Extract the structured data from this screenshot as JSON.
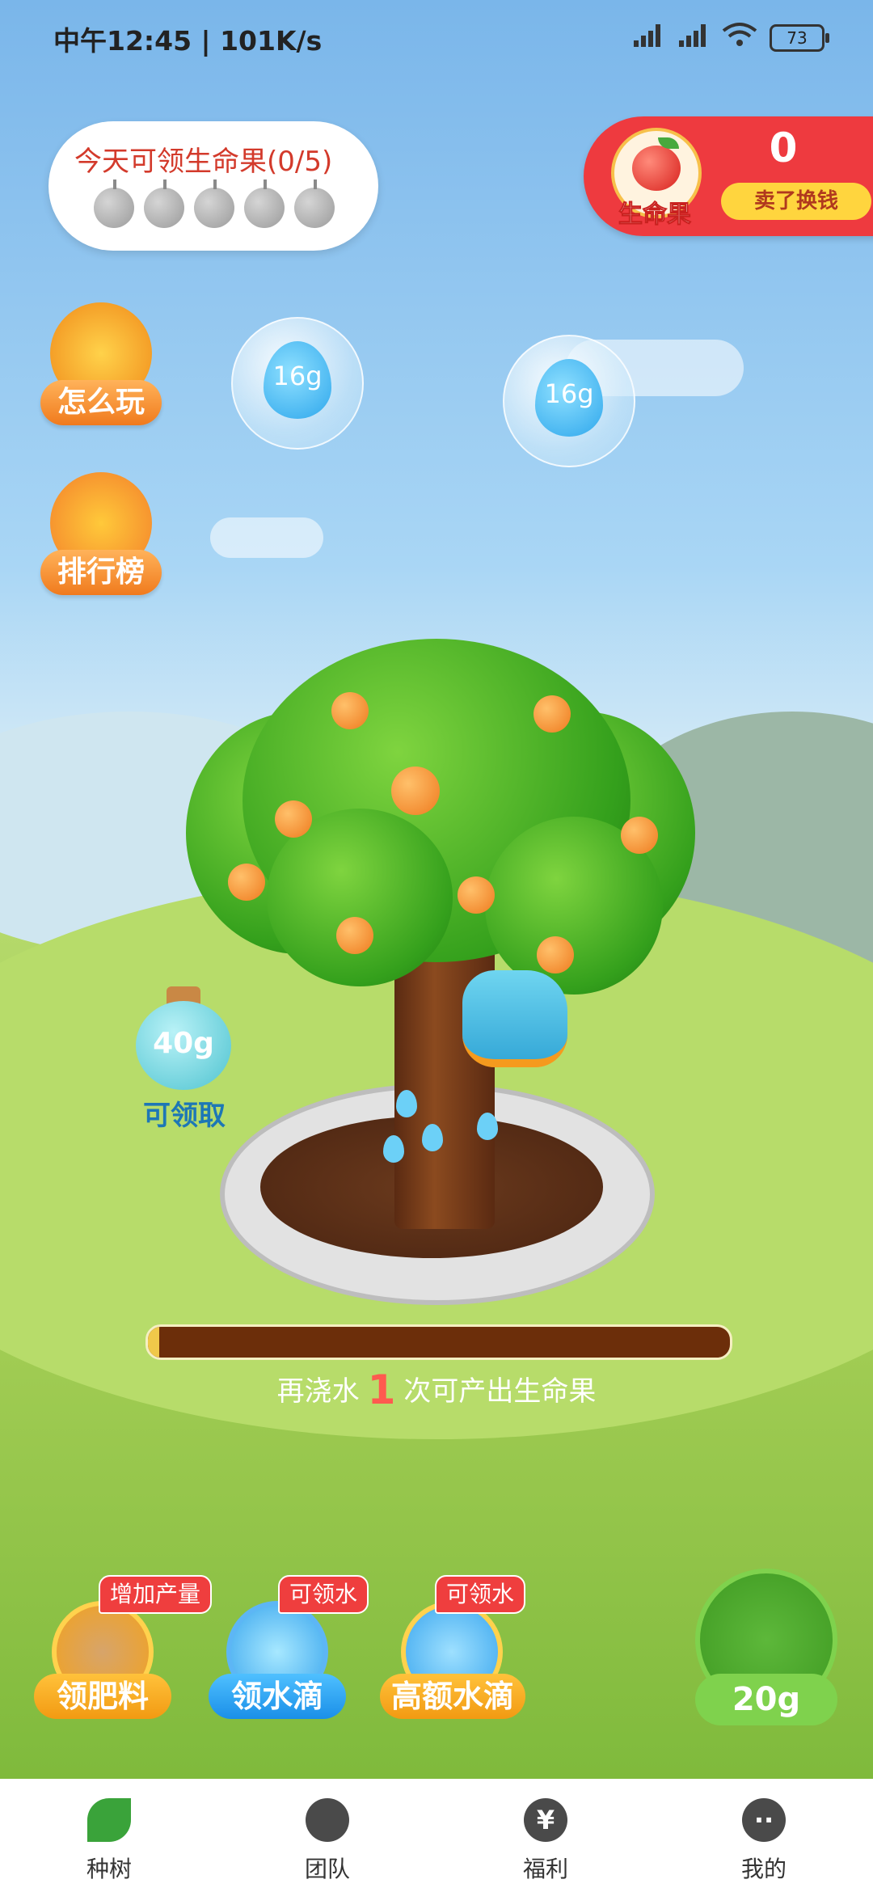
{
  "status_bar": {
    "time": "中午12:45 | 101K/s",
    "battery": "73"
  },
  "today_card": {
    "title": "今天可领生命果(0/5)",
    "apples_collected": 0,
    "apples_total": 5
  },
  "life_fruit": {
    "label": "生命果",
    "count": "0",
    "sell_button": "卖了换钱"
  },
  "side_buttons": {
    "how_to_play": "怎么玩",
    "leaderboard": "排行榜"
  },
  "water_bubbles": [
    "16g",
    "16g"
  ],
  "bottle": {
    "value": "40g",
    "label": "可领取"
  },
  "growth": {
    "prefix": "再浇水",
    "count": "1",
    "suffix": "次可产出生命果",
    "progress": 0.02
  },
  "actions": [
    {
      "label": "领肥料",
      "tag": "增加产量"
    },
    {
      "label": "领水滴",
      "tag": "可领水"
    },
    {
      "label": "高额水滴",
      "tag": "可领水"
    }
  ],
  "kettle": {
    "value": "20g"
  },
  "tabs": [
    {
      "label": "种树",
      "icon": "sprout-icon"
    },
    {
      "label": "团队",
      "icon": "apple-icon"
    },
    {
      "label": "福利",
      "icon": "yen-icon"
    },
    {
      "label": "我的",
      "icon": "face-icon"
    }
  ],
  "colors": {
    "accent_red": "#ee3a3f",
    "orange": "#f07a1d",
    "active_tab": "#3aa33a"
  }
}
